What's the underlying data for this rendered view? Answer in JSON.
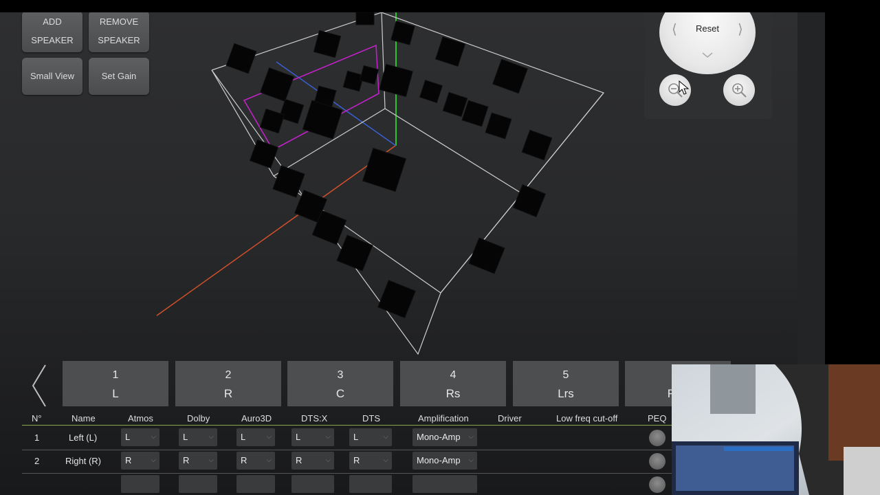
{
  "toolbar": {
    "add_speaker_line1": "ADD",
    "add_speaker_line2": "SPEAKER",
    "remove_speaker_line1": "REMOVE",
    "remove_speaker_line2": "SPEAKER",
    "small_view": "Small View",
    "set_gain": "Set Gain"
  },
  "nav": {
    "reset": "Reset",
    "left_arrow": "⟨",
    "right_arrow": "⟩",
    "zoom_out_icon": "zoom-out-icon",
    "zoom_in_icon": "zoom-in-icon"
  },
  "warning": {
    "icon": "warning-icon",
    "color": "#e8232a"
  },
  "speaker_tabs": [
    {
      "num": "1",
      "ch": "L"
    },
    {
      "num": "2",
      "ch": "R"
    },
    {
      "num": "3",
      "ch": "C"
    },
    {
      "num": "4",
      "ch": "Rs"
    },
    {
      "num": "5",
      "ch": "Lrs"
    },
    {
      "num": "",
      "ch": "R"
    }
  ],
  "table": {
    "headers": [
      "N°",
      "Name",
      "Atmos",
      "Dolby",
      "Auro3D",
      "DTS:X",
      "DTS",
      "Amplification",
      "Driver",
      "Low freq cut-off",
      "PEQ"
    ],
    "rows": [
      {
        "n": "1",
        "name": "Left (L)",
        "atmos": "L",
        "dolby": "L",
        "auro3d": "L",
        "dtsx": "L",
        "dts": "L",
        "amplification": "Mono-Amp",
        "driver": "",
        "low_freq": ""
      },
      {
        "n": "2",
        "name": "Right (R)",
        "atmos": "R",
        "dolby": "R",
        "auro3d": "R",
        "dtsx": "R",
        "dts": "R",
        "amplification": "Mono-Amp",
        "driver": "",
        "low_freq": ""
      }
    ]
  },
  "colors": {
    "x_axis": "#d2502a",
    "y_axis": "#2ec22e",
    "z_axis": "#3a5fd0",
    "selection_box": "#c021c8",
    "room_wireframe": "#cfcfcf",
    "header_underline": "#8aa84a"
  }
}
